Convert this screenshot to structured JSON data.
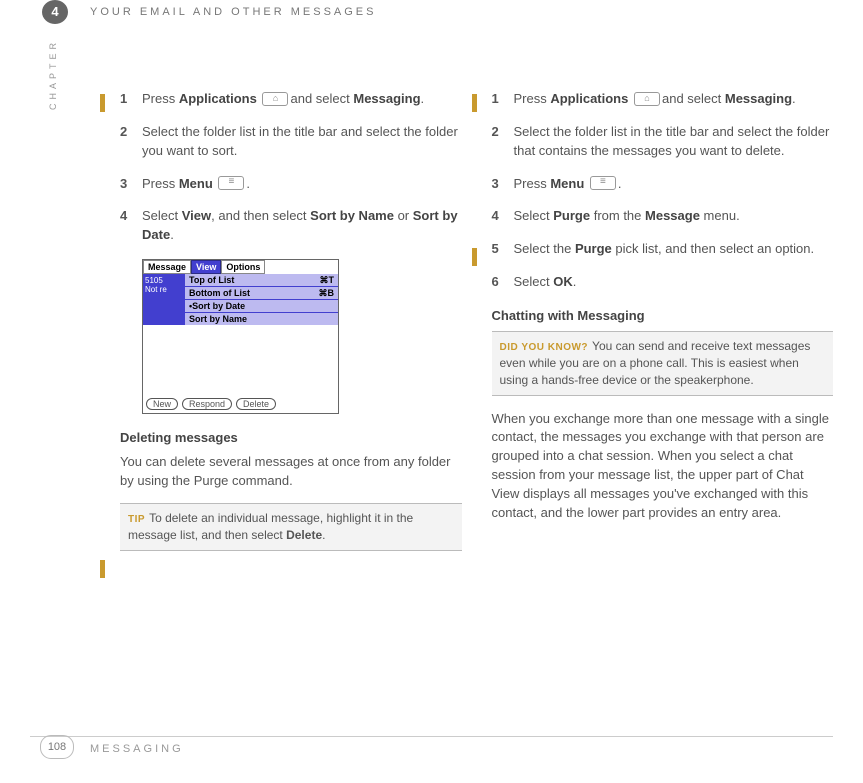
{
  "header": {
    "chapter_number": "4",
    "title": "YOUR EMAIL AND OTHER MESSAGES",
    "side_label": "CHAPTER"
  },
  "left": {
    "steps": [
      {
        "n": "1",
        "pre": "Press ",
        "b1": "Applications",
        "mid": " ",
        "icon": "home",
        "post": "and select ",
        "b2": "Messaging",
        "end": "."
      },
      {
        "n": "2",
        "text": "Select the folder list in the title bar and select the folder you want to sort."
      },
      {
        "n": "3",
        "pre": "Press ",
        "b1": "Menu",
        "mid": " ",
        "icon": "menu",
        "end": "."
      },
      {
        "n": "4",
        "pre": "Select ",
        "b1": "View",
        "mid": ", and then select ",
        "b2": "Sort by Name",
        "mid2": " or ",
        "b3": "Sort by Date",
        "end": "."
      }
    ],
    "screenshot": {
      "tabs": [
        "Message",
        "View",
        "Options"
      ],
      "menu": [
        "Top of List",
        "Bottom of List",
        "•Sort by Date",
        "Sort by Name"
      ],
      "left_items": [
        "5105",
        "Not re"
      ],
      "shortcut1": "⌘T",
      "shortcut2": "⌘B",
      "buttons": [
        "New",
        "Respond",
        "Delete"
      ]
    },
    "section_title": "Deleting messages",
    "section_para": "You can delete several messages at once from any folder by using the Purge command.",
    "tip_label": "TIP",
    "tip_text": "To delete an individual message, highlight it in the message list, and then select ",
    "tip_bold": "Delete",
    "tip_end": "."
  },
  "right": {
    "steps": [
      {
        "n": "1",
        "pre": "Press ",
        "b1": "Applications",
        "mid": " ",
        "icon": "home",
        "post": "and select ",
        "b2": "Messaging",
        "end": "."
      },
      {
        "n": "2",
        "text": "Select the folder list in the title bar and select the folder that contains the messages you want to delete."
      },
      {
        "n": "3",
        "pre": "Press ",
        "b1": "Menu",
        "mid": " ",
        "icon": "menu",
        "end": "."
      },
      {
        "n": "4",
        "pre": "Select ",
        "b1": "Purge",
        "mid": " from the ",
        "b2": "Message",
        "end": " menu."
      },
      {
        "n": "5",
        "pre": "Select the ",
        "b1": "Purge",
        "mid": " pick list, and then select an option.",
        "end": ""
      },
      {
        "n": "6",
        "pre": "Select ",
        "b1": "OK",
        "end": "."
      }
    ],
    "section_title": "Chatting with Messaging",
    "dyk_label": "DID YOU KNOW?",
    "dyk_text": "You can send and receive text messages even while you are on a phone call. This is easiest when using a hands-free device or the speakerphone.",
    "para": "When you exchange more than one message with a single contact, the messages you exchange with that person are grouped into a chat session. When you select a chat session from your message list, the upper part of Chat View displays all messages you've exchanged with this contact, and the lower part provides an entry area."
  },
  "footer": {
    "page": "108",
    "text": "MESSAGING"
  }
}
